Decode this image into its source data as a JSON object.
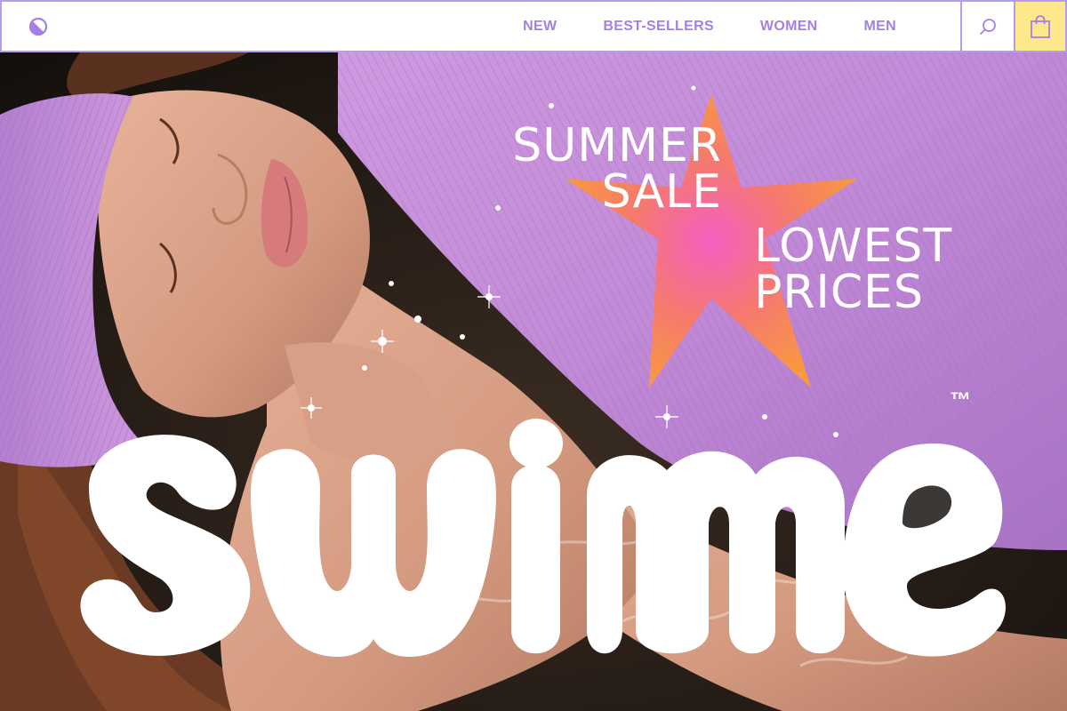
{
  "header": {
    "nav": [
      "NEW",
      "BEST-SELLERS",
      "WOMEN",
      "MEN"
    ],
    "search_icon": "search-icon",
    "cart_icon": "shopping-bag-icon",
    "logo_icon": "half-circle-logo-icon"
  },
  "hero": {
    "sale_line1": "SUMMER",
    "sale_line2": "SALE",
    "price_line1": "LOWEST",
    "price_line2": "PRICES",
    "brand": "swime",
    "trademark": "™"
  },
  "colors": {
    "accent": "#a57fe6",
    "border": "#b59cf0",
    "cart_bg": "#fde98b",
    "star_orange": "#f7914a",
    "star_pink": "#f36ab8",
    "swimsuit": "#c48fd8"
  }
}
